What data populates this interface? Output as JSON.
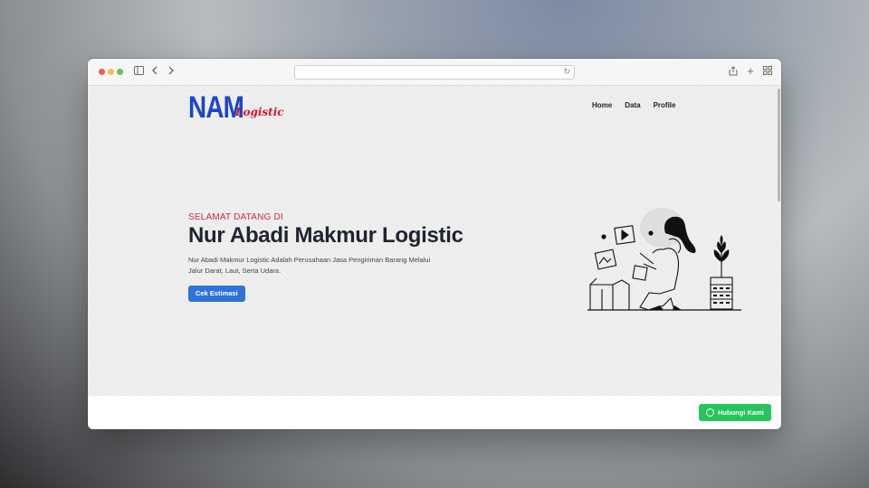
{
  "browser": {
    "url_text": "",
    "icons": [
      "sidebar-icon",
      "back-icon",
      "forward-icon",
      "reload-icon",
      "share-icon",
      "new-tab-icon",
      "tab-overview-icon"
    ]
  },
  "header": {
    "logo_main": "NAM",
    "logo_sub": "Logistic",
    "nav": [
      {
        "label": "Home"
      },
      {
        "label": "Data"
      },
      {
        "label": "Profile"
      }
    ]
  },
  "hero": {
    "kicker": "SELAMAT DATANG DI",
    "title": "Nur Abadi Makmur Logistic",
    "description": "Nur Abadi Makmur Logistic Adalah Perusahaan Jasa Pengiriman Barang Melalui Jalur Darat, Laut, Serta Udara.",
    "cta_label": "Cek Estimasi"
  },
  "floating": {
    "contact_label": "Hubungi Kami"
  },
  "colors": {
    "brand_blue": "#1a46c8",
    "brand_red": "#d1182b",
    "cta": "#2f73d8",
    "whatsapp": "#26c55b"
  }
}
